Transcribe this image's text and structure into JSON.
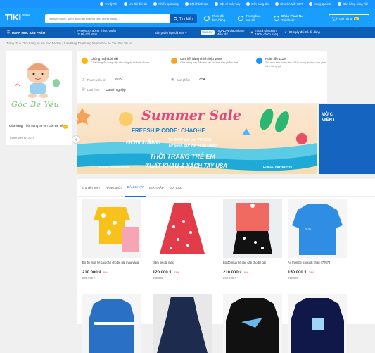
{
  "topbar": {
    "items": [
      {
        "icon": "shield-check-icon",
        "label": "Trợ lý Tiki"
      },
      {
        "icon": "tag-icon",
        "label": "Ưu đãi đối tác"
      },
      {
        "icon": "ticket-icon",
        "label": "Phiếu quà tặng"
      },
      {
        "icon": "hotel-icon",
        "label": "Đặt khách sạn"
      },
      {
        "icon": "plane-icon",
        "label": "Đặt vé máy bay"
      },
      {
        "icon": "store-icon",
        "label": "Bán hàng tân"
      },
      {
        "icon": "gift-icon",
        "label": "Khuyến Mãi HOT"
      },
      {
        "icon": "globe-icon",
        "label": "Hàng quốc tế"
      },
      {
        "icon": "handshake-icon",
        "label": "Bán hàng cùng Tiki"
      }
    ]
  },
  "header": {
    "logo": "TIKI",
    "logo_tag": "Tốt & Nhanh",
    "search_placeholder": "Tìm sản phẩm, danh mục hay thương hiệu mong muốn ...",
    "search_button": "Tìm kiếm",
    "orders_line1": "Theo dõi",
    "orders_line2": "đơn hàng",
    "notify_line1": "Thông báo",
    "notify_line2": "của tôi",
    "account_line1": "Chào Phan N..",
    "account_line2": "Tài khoản",
    "cart_label": "Giỏ hàng",
    "cart_count": "0"
  },
  "subnav": {
    "category": "DANH MỤC SẢN PHẨM",
    "location_line1": "Phường Trường Thịnh, Quận",
    "location_line2": "2, Hồ Chí Minh",
    "viewed": "Sản phẩm bạn đã xem",
    "tikinow_badge": "TIKINOW",
    "tikinow_line1": "TIKINOW giao nhanh",
    "tikinow_line2": "Miễn phí",
    "genuine_line1": "Tất cả sản phẩm",
    "genuine_line2": "100% chính hãng",
    "return_line1": "30 ngày đổi trả dễ dàng"
  },
  "breadcrumb": "Trang chủ  ›  Thời trang trẻ em Góc Bé Yêu | Cửa hàng Thời trang trẻ em Góc Bé Yêu trên Tiki.vn",
  "shop": {
    "logo_text": "Góc Bé Yêu",
    "name": "Cửa hàng: Thời trang trẻ em Góc Bé Yêu",
    "since": "Thành viên từ: 2019"
  },
  "shop_info": {
    "badges": [
      {
        "icon": "medal-icon",
        "title": "Chứng nhận bởi Tiki",
        "desc": "Cửa hàng đã cung cấp đầy đủ giấy tờ kinh doanh"
      },
      {
        "icon": "tiki-gold-icon",
        "title": "Cam kết hàng chính hiệu 100%",
        "desc": "Cửa hàng này đã cam kết chỉ bán sản phẩm thật"
      },
      {
        "icon": "return-icon",
        "title": "Hoàn tiền 111%",
        "desc": "Tiki mục tiếp hoàn tiền 111% trong trường hợp phát hiện hàng giả"
      }
    ],
    "member_label": "Thành viên từ",
    "member_value": "2019",
    "products_label": "Sản phẩm",
    "products_value": "854",
    "type_label": "Loại hình",
    "type_value": "Doanh nghiệp"
  },
  "banner": {
    "title": "Summer Sale",
    "freeship": "FREESHIP CODE: CHAOHE",
    "order_label": "ĐƠN HÀNG",
    "line_hcm": "Từ 300K đối với TP.HCM",
    "line_nation": "Từ 500K đối với Toàn Quốc",
    "brand": "THỜI TRANG TRẺ EM",
    "export": "XUẤT KHẨU & XÁCH TAY USA",
    "fb": "FB.COM/THOIGIANTREEM",
    "hotline": "Hotline: 0937562118",
    "right_line1": "MỞ C",
    "right_line2": "MIỄN I"
  },
  "tabs": [
    "Ưu tiên xem",
    "HÀNG MỚI",
    "BÁN CHẠY",
    "GIÁ THẤP",
    "GIÁ CAO"
  ],
  "products": [
    {
      "name": "Bộ đồ mùa hè cao cấp cho bé gái màu vàng",
      "price": "210.000 ₫",
      "discount": "-9%",
      "old": "230.000 ₫"
    },
    {
      "name": "Đầm bé gái maxi",
      "price": "120.000 ₫",
      "discount": "-33%",
      "old": "180.000 ₫"
    },
    {
      "name": "Bộ đồ mùa hè cao cấp cho bé gái",
      "price": "210.000 ₫",
      "discount": "-9%",
      "old": "230.000 ₫"
    },
    {
      "name": "Áo thun bé trai xuất khẩu 477078",
      "price": "150.000 ₫",
      "discount": "-29%",
      "old": "210.000 ₫"
    }
  ],
  "colors": {
    "tiki_blue": "#1a94ff",
    "dark_blue": "#0d5cb6",
    "red": "#ff424e"
  }
}
